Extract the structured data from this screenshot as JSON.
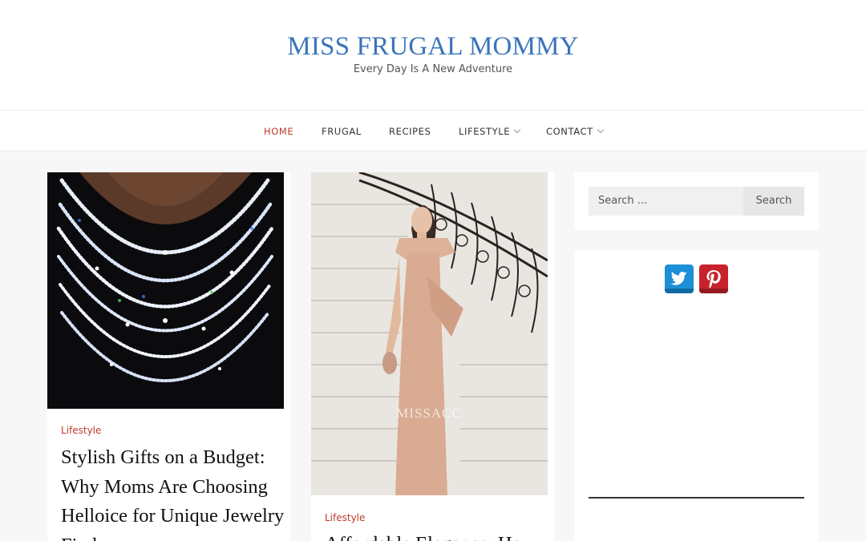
{
  "site": {
    "title": "MISS FRUGAL MOMMY",
    "tagline": "Every Day Is A New Adventure"
  },
  "nav": {
    "items": [
      {
        "label": "HOME",
        "active": true
      },
      {
        "label": "FRUGAL"
      },
      {
        "label": "RECIPES"
      },
      {
        "label": "LIFESTYLE",
        "dropdown": true
      },
      {
        "label": "CONTACT",
        "dropdown": true
      }
    ]
  },
  "posts": [
    {
      "category": "Lifestyle",
      "title_lines": [
        "Stylish Gifts on a Budget:",
        "Why Moms Are Choosing",
        "Helloice for Unique Jewelry",
        "Finds"
      ],
      "image": "diamond-necklaces-photo"
    },
    {
      "category": "Lifestyle",
      "title_lines": [
        "Affordable Elegance: How"
      ],
      "image": "woman-in-dress-on-staircase-photo",
      "watermark": "MISSACC"
    }
  ],
  "sidebar": {
    "search": {
      "placeholder": "Search ...",
      "button_label": "Search"
    },
    "social": [
      {
        "name": "twitter-icon",
        "color": "#1da1f2"
      },
      {
        "name": "pinterest-icon",
        "color": "#c8232c"
      }
    ]
  },
  "colors": {
    "brand": "#3a74b8",
    "accent": "#c0392b"
  }
}
